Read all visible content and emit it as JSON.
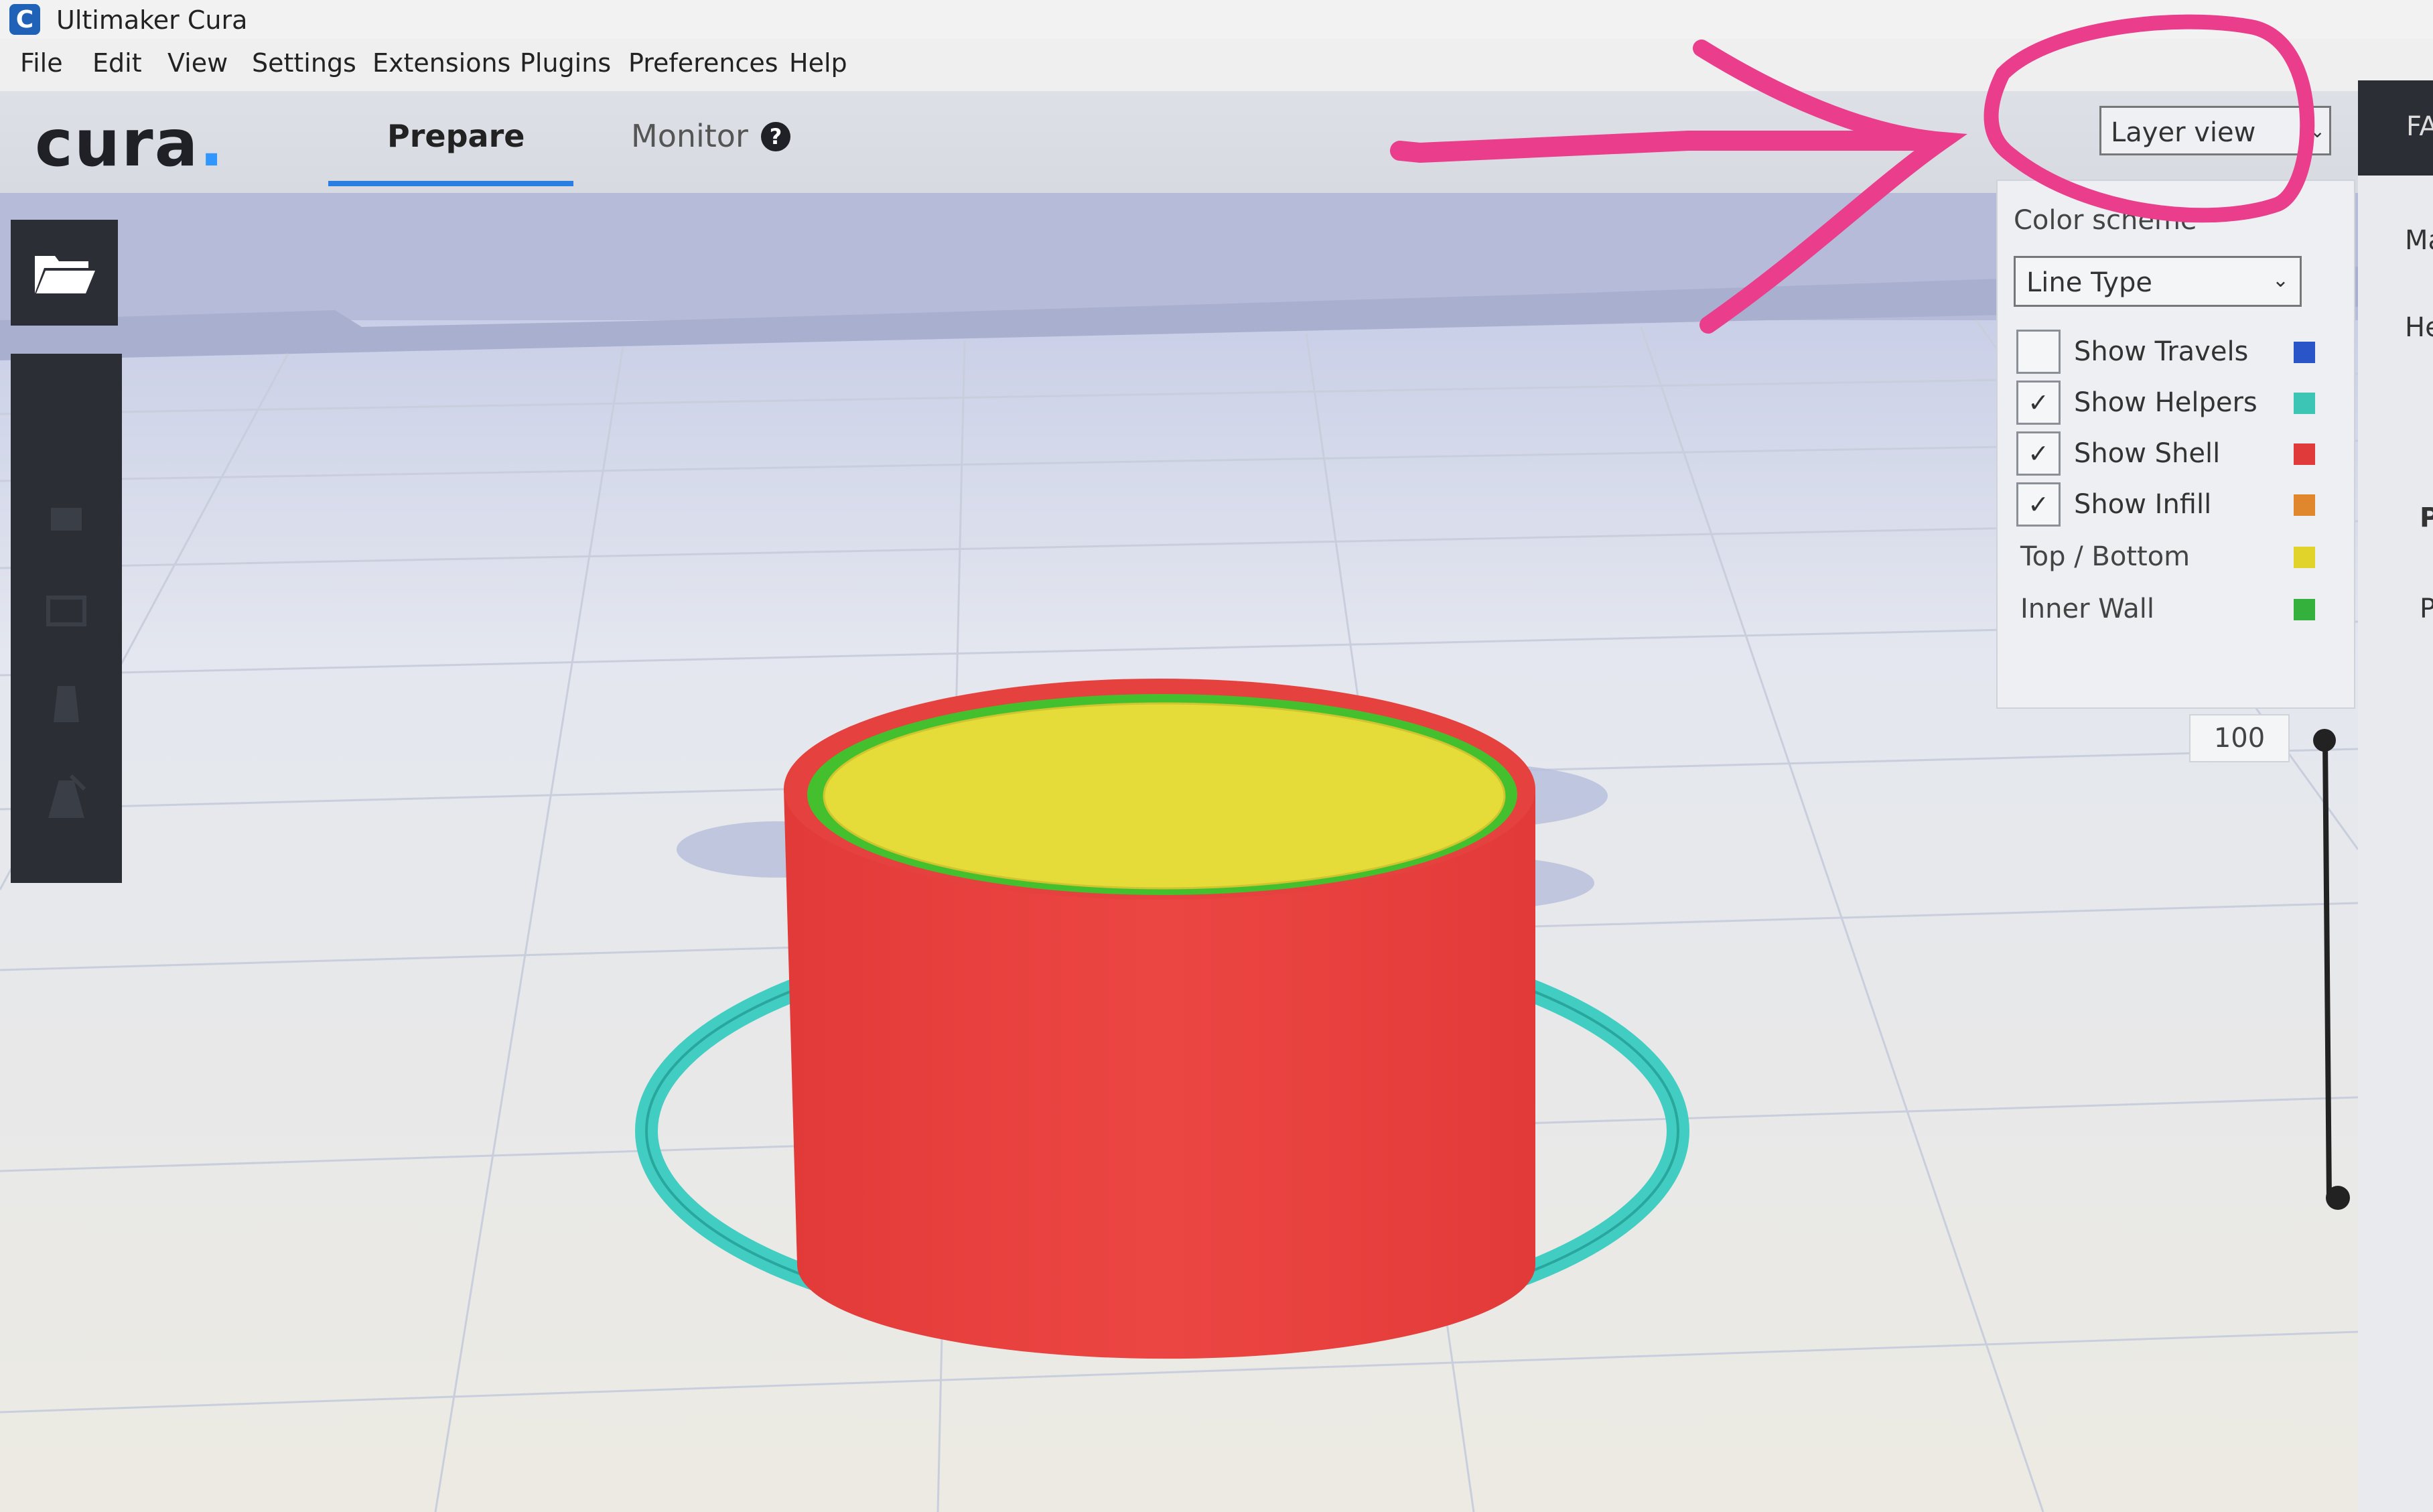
{
  "window": {
    "title": "Ultimaker Cura",
    "icon_letter": "C"
  },
  "menu": [
    "File",
    "Edit",
    "View",
    "Settings",
    "Extensions",
    "Plugins",
    "Preferences",
    "Help"
  ],
  "header": {
    "logo_text": "cura",
    "logo_dot": ".",
    "tabs": {
      "prepare": "Prepare",
      "monitor": "Monitor"
    },
    "monitor_help": "?"
  },
  "view_mode": {
    "selected": "Layer view",
    "arrow": "⌄"
  },
  "layer_panel": {
    "color_scheme_label": "Color scheme",
    "color_scheme_selected": "Line Type",
    "arrow": "⌄",
    "rows": [
      {
        "label": "Show Travels",
        "checked": false,
        "color": "#2a55c8"
      },
      {
        "label": "Show Helpers",
        "checked": true,
        "color": "#3cc4b4"
      },
      {
        "label": "Show Shell",
        "checked": true,
        "color": "#e03a3a"
      },
      {
        "label": "Show Infill",
        "checked": true,
        "color": "#e0872e"
      }
    ],
    "legend": [
      {
        "label": "Top / Bottom",
        "color": "#e2d32a"
      },
      {
        "label": "Inner Wall",
        "color": "#34b03c"
      }
    ],
    "check_mark": "✓"
  },
  "layer_slider": {
    "current_layer": "100"
  },
  "sidebar_partial_labels": [
    "FA",
    "Ma",
    "He",
    "P",
    "P"
  ],
  "colors": {
    "shell": "#e63e3b",
    "top_bottom": "#e8e03a",
    "inner_wall": "#49c03a",
    "skirt": "#45cfc6",
    "annotation": "#ea3d8b",
    "accent": "#2a7de1"
  }
}
